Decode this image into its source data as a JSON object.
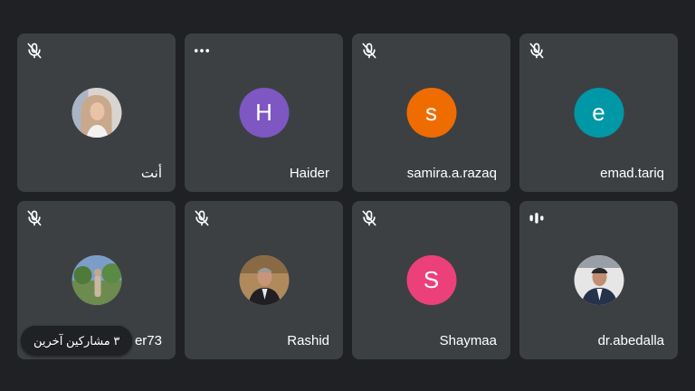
{
  "participants": [
    {
      "name": "أنت",
      "status": "muted",
      "avatar": "photo",
      "initial": ""
    },
    {
      "name": "Haider",
      "status": "more",
      "avatar": "letter",
      "initial": "H",
      "color": "#7e57c2"
    },
    {
      "name": "samira.a.razaq",
      "status": "muted",
      "avatar": "letter",
      "initial": "s",
      "color": "#ef6c00"
    },
    {
      "name": "emad.tariq",
      "status": "muted",
      "avatar": "letter",
      "initial": "e",
      "color": "#0097a7"
    },
    {
      "name": "er73",
      "status": "muted",
      "avatar": "photo",
      "initial": ""
    },
    {
      "name": "Rashid",
      "status": "muted",
      "avatar": "photo",
      "initial": ""
    },
    {
      "name": "Shaymaa",
      "status": "muted",
      "avatar": "letter",
      "initial": "S",
      "color": "#ec407a"
    },
    {
      "name": "dr.abedalla",
      "status": "speaking",
      "avatar": "photo",
      "initial": ""
    }
  ],
  "others_chip": {
    "label": "٣ مشاركين آخرين"
  },
  "colors": {
    "background": "#202124",
    "tile": "#3c4043"
  }
}
